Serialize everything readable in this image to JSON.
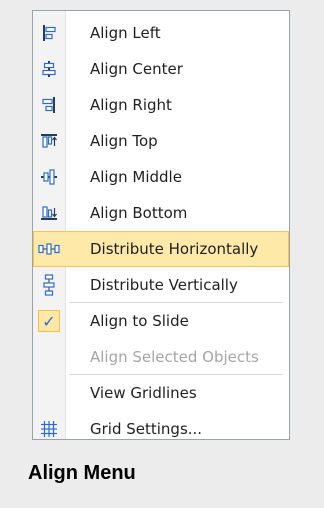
{
  "menu": {
    "items": [
      {
        "label": "Align Left",
        "icon": "align-left-icon",
        "enabled": true
      },
      {
        "label": "Align Center",
        "icon": "align-center-icon",
        "enabled": true
      },
      {
        "label": "Align Right",
        "icon": "align-right-icon",
        "enabled": true
      },
      {
        "label": "Align Top",
        "icon": "align-top-icon",
        "enabled": true
      },
      {
        "label": "Align Middle",
        "icon": "align-middle-icon",
        "enabled": true
      },
      {
        "label": "Align Bottom",
        "icon": "align-bottom-icon",
        "enabled": true
      },
      {
        "label": "Distribute Horizontally",
        "icon": "distribute-horizontally-icon",
        "enabled": true,
        "highlighted": true
      },
      {
        "label": "Distribute Vertically",
        "icon": "distribute-vertically-icon",
        "enabled": true
      },
      {
        "label": "Align to Slide",
        "icon": "checkmark-icon",
        "enabled": true,
        "checked": true
      },
      {
        "label": "Align Selected Objects",
        "enabled": false
      },
      {
        "label": "View Gridlines",
        "enabled": true
      },
      {
        "label": "Grid Settings...",
        "icon": "grid-icon",
        "enabled": true
      }
    ],
    "check_glyph": "✓"
  },
  "caption": "Align Menu",
  "colors": {
    "highlight": "#ffe9a8",
    "icon_blue": "#2b6bd1",
    "disabled_text": "#a5a5a5"
  }
}
